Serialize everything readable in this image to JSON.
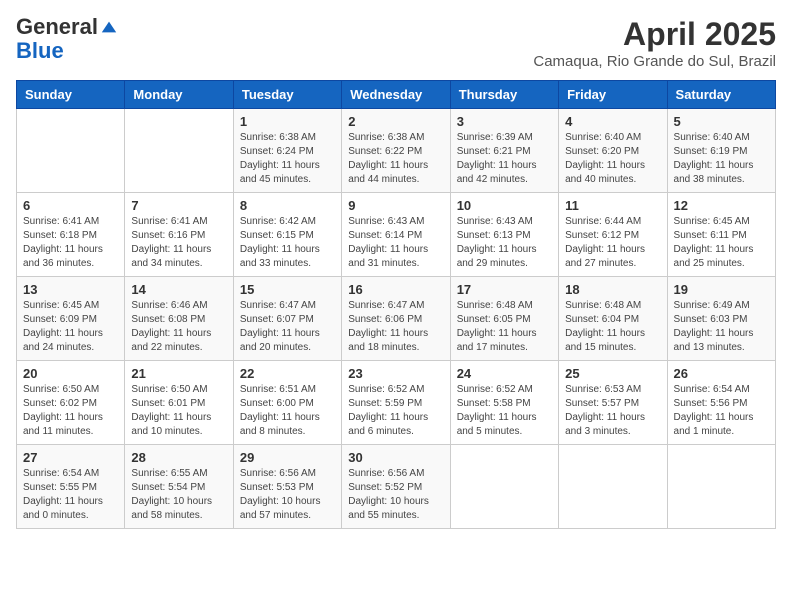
{
  "logo": {
    "general": "General",
    "blue": "Blue"
  },
  "header": {
    "title": "April 2025",
    "subtitle": "Camaqua, Rio Grande do Sul, Brazil"
  },
  "weekdays": [
    "Sunday",
    "Monday",
    "Tuesday",
    "Wednesday",
    "Thursday",
    "Friday",
    "Saturday"
  ],
  "weeks": [
    [
      {
        "day": "",
        "info": ""
      },
      {
        "day": "",
        "info": ""
      },
      {
        "day": "1",
        "info": "Sunrise: 6:38 AM\nSunset: 6:24 PM\nDaylight: 11 hours and 45 minutes."
      },
      {
        "day": "2",
        "info": "Sunrise: 6:38 AM\nSunset: 6:22 PM\nDaylight: 11 hours and 44 minutes."
      },
      {
        "day": "3",
        "info": "Sunrise: 6:39 AM\nSunset: 6:21 PM\nDaylight: 11 hours and 42 minutes."
      },
      {
        "day": "4",
        "info": "Sunrise: 6:40 AM\nSunset: 6:20 PM\nDaylight: 11 hours and 40 minutes."
      },
      {
        "day": "5",
        "info": "Sunrise: 6:40 AM\nSunset: 6:19 PM\nDaylight: 11 hours and 38 minutes."
      }
    ],
    [
      {
        "day": "6",
        "info": "Sunrise: 6:41 AM\nSunset: 6:18 PM\nDaylight: 11 hours and 36 minutes."
      },
      {
        "day": "7",
        "info": "Sunrise: 6:41 AM\nSunset: 6:16 PM\nDaylight: 11 hours and 34 minutes."
      },
      {
        "day": "8",
        "info": "Sunrise: 6:42 AM\nSunset: 6:15 PM\nDaylight: 11 hours and 33 minutes."
      },
      {
        "day": "9",
        "info": "Sunrise: 6:43 AM\nSunset: 6:14 PM\nDaylight: 11 hours and 31 minutes."
      },
      {
        "day": "10",
        "info": "Sunrise: 6:43 AM\nSunset: 6:13 PM\nDaylight: 11 hours and 29 minutes."
      },
      {
        "day": "11",
        "info": "Sunrise: 6:44 AM\nSunset: 6:12 PM\nDaylight: 11 hours and 27 minutes."
      },
      {
        "day": "12",
        "info": "Sunrise: 6:45 AM\nSunset: 6:11 PM\nDaylight: 11 hours and 25 minutes."
      }
    ],
    [
      {
        "day": "13",
        "info": "Sunrise: 6:45 AM\nSunset: 6:09 PM\nDaylight: 11 hours and 24 minutes."
      },
      {
        "day": "14",
        "info": "Sunrise: 6:46 AM\nSunset: 6:08 PM\nDaylight: 11 hours and 22 minutes."
      },
      {
        "day": "15",
        "info": "Sunrise: 6:47 AM\nSunset: 6:07 PM\nDaylight: 11 hours and 20 minutes."
      },
      {
        "day": "16",
        "info": "Sunrise: 6:47 AM\nSunset: 6:06 PM\nDaylight: 11 hours and 18 minutes."
      },
      {
        "day": "17",
        "info": "Sunrise: 6:48 AM\nSunset: 6:05 PM\nDaylight: 11 hours and 17 minutes."
      },
      {
        "day": "18",
        "info": "Sunrise: 6:48 AM\nSunset: 6:04 PM\nDaylight: 11 hours and 15 minutes."
      },
      {
        "day": "19",
        "info": "Sunrise: 6:49 AM\nSunset: 6:03 PM\nDaylight: 11 hours and 13 minutes."
      }
    ],
    [
      {
        "day": "20",
        "info": "Sunrise: 6:50 AM\nSunset: 6:02 PM\nDaylight: 11 hours and 11 minutes."
      },
      {
        "day": "21",
        "info": "Sunrise: 6:50 AM\nSunset: 6:01 PM\nDaylight: 11 hours and 10 minutes."
      },
      {
        "day": "22",
        "info": "Sunrise: 6:51 AM\nSunset: 6:00 PM\nDaylight: 11 hours and 8 minutes."
      },
      {
        "day": "23",
        "info": "Sunrise: 6:52 AM\nSunset: 5:59 PM\nDaylight: 11 hours and 6 minutes."
      },
      {
        "day": "24",
        "info": "Sunrise: 6:52 AM\nSunset: 5:58 PM\nDaylight: 11 hours and 5 minutes."
      },
      {
        "day": "25",
        "info": "Sunrise: 6:53 AM\nSunset: 5:57 PM\nDaylight: 11 hours and 3 minutes."
      },
      {
        "day": "26",
        "info": "Sunrise: 6:54 AM\nSunset: 5:56 PM\nDaylight: 11 hours and 1 minute."
      }
    ],
    [
      {
        "day": "27",
        "info": "Sunrise: 6:54 AM\nSunset: 5:55 PM\nDaylight: 11 hours and 0 minutes."
      },
      {
        "day": "28",
        "info": "Sunrise: 6:55 AM\nSunset: 5:54 PM\nDaylight: 10 hours and 58 minutes."
      },
      {
        "day": "29",
        "info": "Sunrise: 6:56 AM\nSunset: 5:53 PM\nDaylight: 10 hours and 57 minutes."
      },
      {
        "day": "30",
        "info": "Sunrise: 6:56 AM\nSunset: 5:52 PM\nDaylight: 10 hours and 55 minutes."
      },
      {
        "day": "",
        "info": ""
      },
      {
        "day": "",
        "info": ""
      },
      {
        "day": "",
        "info": ""
      }
    ]
  ]
}
